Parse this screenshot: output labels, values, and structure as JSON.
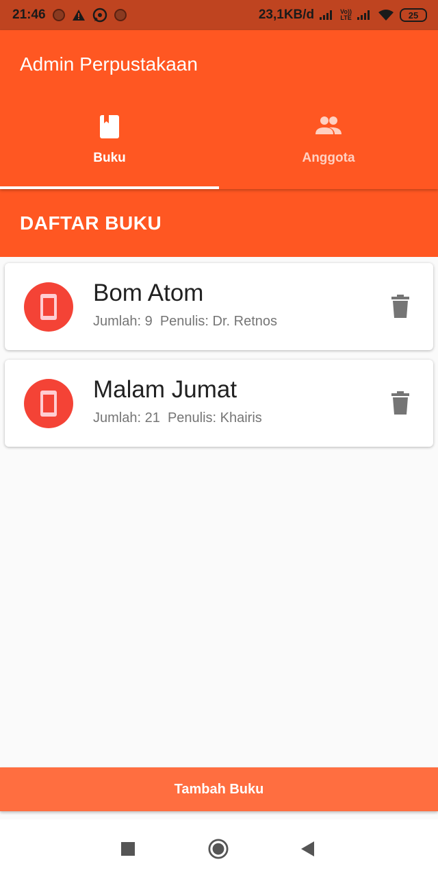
{
  "status_bar": {
    "time": "21:46",
    "network_speed": "23,1KB/d",
    "battery": "25",
    "volte_top": "Vo))",
    "volte_bottom": "LTE"
  },
  "app_bar": {
    "title": "Admin Perpustakaan"
  },
  "tabs": [
    {
      "label": "Buku",
      "icon": "book-icon",
      "selected": true
    },
    {
      "label": "Anggota",
      "icon": "people-icon",
      "selected": false
    }
  ],
  "section": {
    "title": "DAFTAR BUKU"
  },
  "books": [
    {
      "title": "Bom Atom",
      "details": "Jumlah: 9  Penulis: Dr. Retnos"
    },
    {
      "title": "Malam Jumat",
      "details": "Jumlah: 21  Penulis: Khairis"
    }
  ],
  "footer": {
    "add_button": "Tambah Buku"
  },
  "colors": {
    "primary": "#ff5722",
    "status_bar": "#bf4420",
    "avatar": "#f44336",
    "button": "#ff6e40"
  }
}
